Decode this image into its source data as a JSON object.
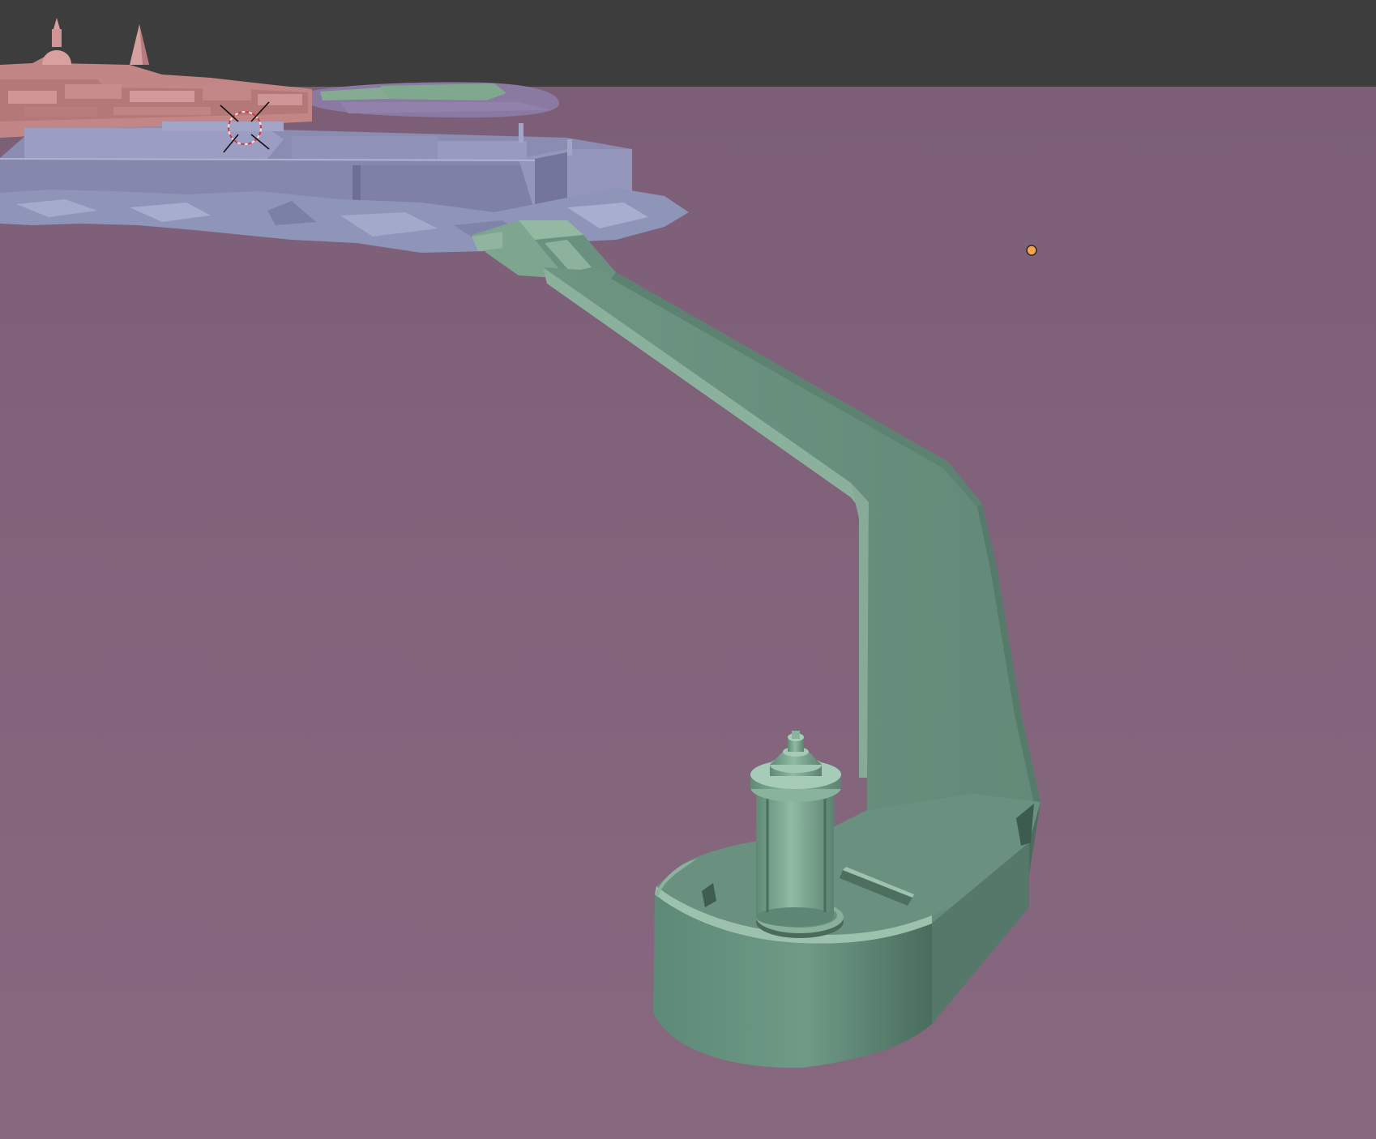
{
  "viewport": {
    "background_color": "#3d3d3d",
    "ground_color": "#81627a"
  },
  "scene": {
    "objects": [
      {
        "name": "town-buildings",
        "color": "#c8898a"
      },
      {
        "name": "fortress-walls",
        "color": "#8d8fb3"
      },
      {
        "name": "rocky-shoreline",
        "color": "#9096b8"
      },
      {
        "name": "distant-green-buildings",
        "color": "#7fa88f"
      },
      {
        "name": "breakwater",
        "color": "#6b8f7e"
      },
      {
        "name": "lighthouse",
        "color": "#7fa892"
      }
    ]
  },
  "overlays": {
    "cursor_3d": "3d-cursor-icon",
    "light": "light-object-icon",
    "light_color": "#f5a54a"
  }
}
